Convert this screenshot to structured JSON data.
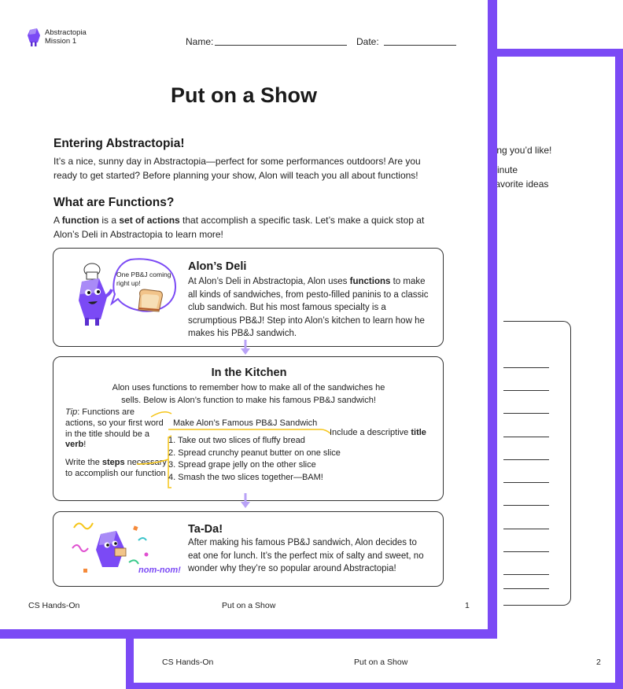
{
  "page2": {
    "snippets": [
      "ning you’d like!",
      "minute",
      "-favorite ideas"
    ],
    "footer": {
      "left": "CS Hands-On",
      "center": "Put on a Show",
      "page": "2"
    }
  },
  "header": {
    "brand_line1": "Abstractopia",
    "brand_line2": "Mission 1",
    "name_label": "Name:",
    "date_label": "Date:"
  },
  "title": "Put on a Show",
  "section1": {
    "heading": "Entering Abstractopia!",
    "text": "It’s a nice, sunny day in Abstractopia—perfect for some performances outdoors! Are you ready to get started? Before planning your show, Alon will teach you all about functions!"
  },
  "section2": {
    "heading": "What are Functions?",
    "p_a": "A ",
    "p_b": "function",
    "p_c": " is a ",
    "p_d": "set of actions",
    "p_e": " that accomplish a specific task. Let’s make a quick stop at Alon’s Deli in Abstractopia to learn more!"
  },
  "deli": {
    "speech": "One PB&J coming right up!",
    "title": "Alon’s Deli",
    "t1": "At Alon’s Deli in Abstractopia, Alon uses ",
    "t2": "functions",
    "t3": " to make all kinds of sandwiches, from pesto-filled paninis to a classic club sandwich. But his most famous specialty is a scrumptious PB&J! Step into Alon’s kitchen to learn how he makes his PB&J sandwich."
  },
  "kitchen": {
    "title": "In the Kitchen",
    "intro": "Alon uses functions to remember how to make all of the sandwiches he sells. Below is Alon’s function to make his famous PB&J sandwich!",
    "tip_a": "Tip",
    "tip_b": ": Functions are actions, so your first word in the title should be a ",
    "tip_c": "verb",
    "tip_d": "!",
    "steps_a": "Write the ",
    "steps_b": "steps",
    "steps_c": " necessary to accomplish our function",
    "fn_title": "Make Alon’s Famous PB&J Sandwich",
    "title_note_a": "Include a descriptive ",
    "title_note_b": "title",
    "steps": [
      "1. Take out two slices of fluffy bread",
      "2. Spread crunchy peanut butter on one slice",
      "3. Spread grape jelly on the other slice",
      "4. Smash the two slices together—BAM!"
    ]
  },
  "tada": {
    "title": "Ta-Da!",
    "text": "After making his famous PB&J sandwich, Alon decides to eat one for lunch. It’s the perfect mix of salty and sweet, no wonder why they’re so popular around Abstractopia!",
    "nom": "nom-nom!"
  },
  "footer": {
    "left": "CS Hands-On",
    "center": "Put on a Show",
    "page": "1"
  },
  "colors": {
    "accent": "#7b4af5",
    "highlight": "#f5c518",
    "arrow": "#b9a2f7"
  },
  "icons": [
    "abstractopia-logo-icon",
    "chef-character-icon",
    "sandwich-icon",
    "arrow-down-icon",
    "confetti-icon"
  ]
}
